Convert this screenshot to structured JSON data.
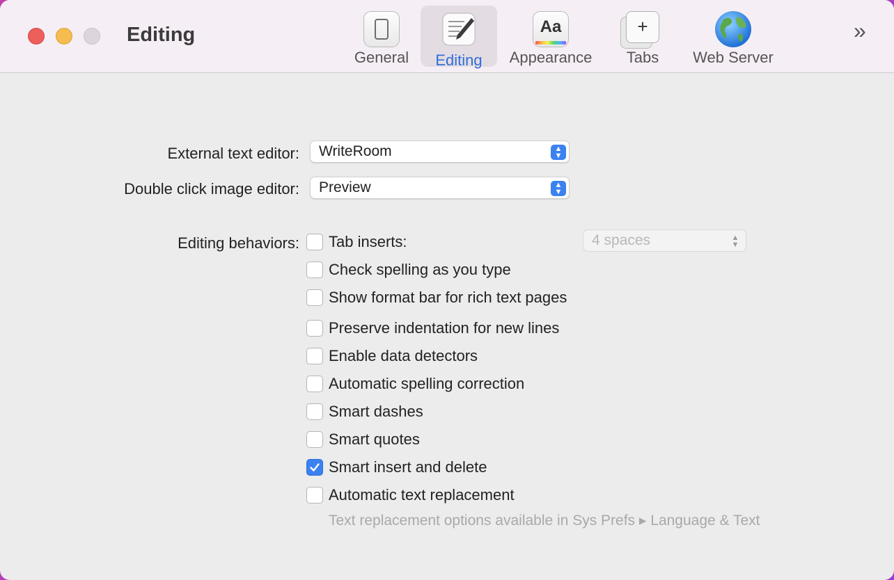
{
  "window": {
    "title": "Editing"
  },
  "toolbar": {
    "items": [
      {
        "label": "General",
        "icon": "phone-device-icon"
      },
      {
        "label": "Editing",
        "icon": "pencil-document-icon",
        "selected": true
      },
      {
        "label": "Appearance",
        "icon": "font-aa-icon"
      },
      {
        "label": "Tabs",
        "icon": "new-tab-plus-icon"
      },
      {
        "label": "Web Server",
        "icon": "globe-icon"
      }
    ],
    "overflow_icon": "chevron-double-right-icon"
  },
  "form": {
    "external_editor": {
      "label": "External text editor:",
      "value": "WriteRoom"
    },
    "image_editor": {
      "label": "Double click image editor:",
      "value": "Preview"
    },
    "behaviors_label": "Editing behaviors:",
    "tab_inserts": {
      "value": "4 spaces",
      "enabled": false
    },
    "checkboxes": [
      {
        "label": "Tab inserts:",
        "checked": false
      },
      {
        "label": "Check spelling as you type",
        "checked": false
      },
      {
        "label": "Show format bar for rich text pages",
        "checked": false
      },
      {
        "label": "Preserve indentation for new lines",
        "checked": false
      },
      {
        "label": "Enable data detectors",
        "checked": false
      },
      {
        "label": "Automatic spelling correction",
        "checked": false
      },
      {
        "label": "Smart dashes",
        "checked": false
      },
      {
        "label": "Smart quotes",
        "checked": false
      },
      {
        "label": "Smart insert and delete",
        "checked": true
      },
      {
        "label": "Automatic text replacement",
        "checked": false
      }
    ],
    "hint": "Text replacement options available in Sys Prefs ▸ Language & Text"
  },
  "colors": {
    "accent": "#3b82f0",
    "selected_label": "#2f6fd8",
    "close": "#ec5f5a",
    "minimize": "#f5bd4f",
    "zoom_inactive": "#dcd6dc"
  }
}
